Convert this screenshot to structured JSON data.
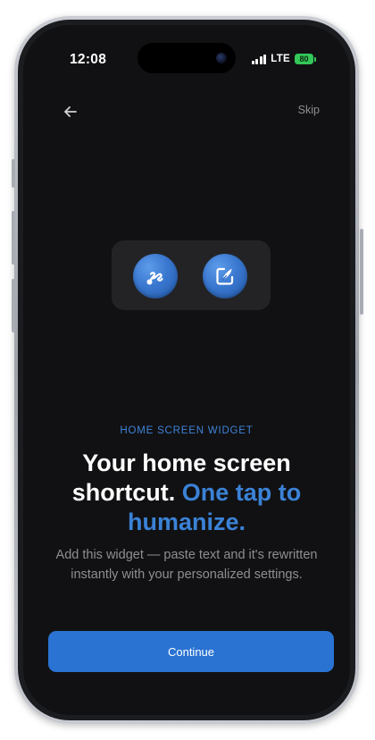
{
  "status_bar": {
    "time": "12:08",
    "network": "LTE",
    "battery": "80"
  },
  "nav": {
    "back_icon": "arrow-left-icon",
    "skip_label": "Skip"
  },
  "widget_preview": {
    "icons": [
      "link-icon",
      "compose-icon"
    ]
  },
  "content": {
    "eyebrow": "HOME SCREEN WIDGET",
    "headline_plain": "Your home screen shortcut. ",
    "headline_accent": "One tap to humanize.",
    "body": "Add this widget — paste text and it's rewritten instantly with your personalized settings."
  },
  "actions": {
    "continue_label": "Continue"
  },
  "colors": {
    "accent": "#3b82d6",
    "button": "#2a73d2",
    "background": "#111113",
    "battery": "#34c759"
  }
}
